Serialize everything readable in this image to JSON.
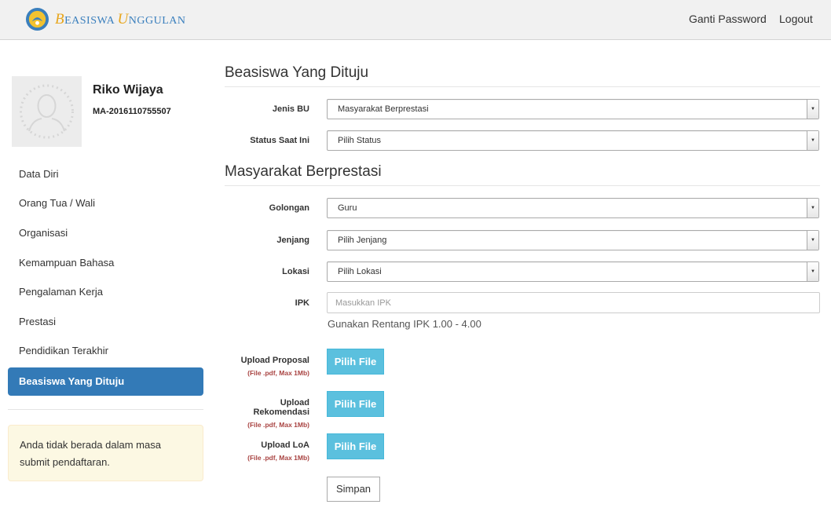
{
  "navbar": {
    "brand_first": "B",
    "brand_rest1": "EASISWA",
    "brand_second": "U",
    "brand_rest2": "NGGULAN",
    "links": [
      "Ganti Password",
      "Logout"
    ]
  },
  "profile": {
    "name": "Riko Wijaya",
    "id": "MA-2016110755507"
  },
  "sidebar": {
    "items": [
      {
        "label": "Data Diri"
      },
      {
        "label": "Orang Tua / Wali"
      },
      {
        "label": "Organisasi"
      },
      {
        "label": "Kemampuan Bahasa"
      },
      {
        "label": "Pengalaman Kerja"
      },
      {
        "label": "Prestasi"
      },
      {
        "label": "Pendidikan Terakhir"
      },
      {
        "label": "Beasiswa Yang Dituju",
        "active": true
      }
    ],
    "alert": "Anda tidak berada dalam masa submit pendaftaran."
  },
  "main": {
    "section1_title": "Beasiswa Yang Dituju",
    "section2_title": "Masyarakat Berprestasi",
    "fields": {
      "jenis_bu": {
        "label": "Jenis BU",
        "value": "Masyarakat Berprestasi"
      },
      "status": {
        "label": "Status Saat Ini",
        "value": "Pilih Status"
      },
      "golongan": {
        "label": "Golongan",
        "value": "Guru"
      },
      "jenjang": {
        "label": "Jenjang",
        "value": "Pilih Jenjang"
      },
      "lokasi": {
        "label": "Lokasi",
        "value": "Pilih Lokasi"
      },
      "ipk": {
        "label": "IPK",
        "placeholder": "Masukkan IPK",
        "help": "Gunakan Rentang IPK 1.00 - 4.00"
      }
    },
    "uploads": [
      {
        "label": "Upload Proposal",
        "note": "(File .pdf, Max 1Mb)",
        "button": "Pilih File"
      },
      {
        "label": "Upload Rekomendasi",
        "note": "(File .pdf, Max 1Mb)",
        "button": "Pilih File"
      },
      {
        "label": "Upload LoA",
        "note": "(File .pdf, Max 1Mb)",
        "button": "Pilih File"
      }
    ],
    "save_label": "Simpan"
  },
  "colors": {
    "primary": "#337ab7",
    "info": "#5bc0de",
    "alert_bg": "#fcf8e3",
    "danger_text": "#a94442",
    "brand_gold": "#e7a61d"
  }
}
